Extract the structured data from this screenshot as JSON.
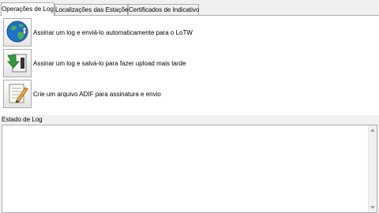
{
  "tabs": [
    {
      "label": "Operações de Log",
      "active": true
    },
    {
      "label": "Localizações das Estações",
      "active": false
    },
    {
      "label": "Certificados de Indicativo",
      "active": false
    }
  ],
  "actions": [
    {
      "icon": "globe-upload-icon",
      "label": "Assinar um log e enviá-lo automaticamente para o LoTW"
    },
    {
      "icon": "save-file-icon",
      "label": "Assinar um log e salvá-lo para fazer upload mais tarde"
    },
    {
      "icon": "notepad-pencil-icon",
      "label": "Crie um arquivo ADIF para assinatura e envio"
    }
  ],
  "log_section": {
    "label": "Estado de Log",
    "content": ""
  }
}
